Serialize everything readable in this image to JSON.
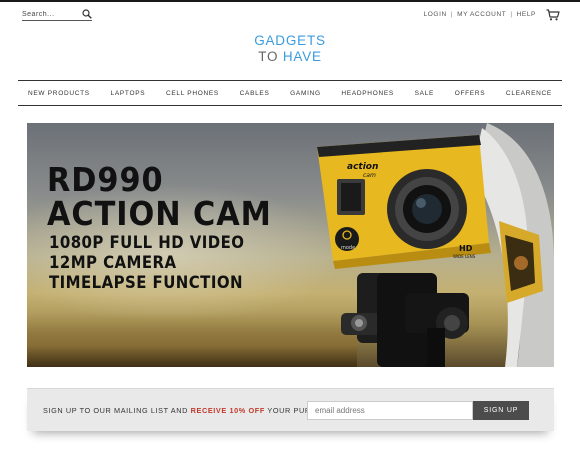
{
  "header": {
    "search": {
      "placeholder": "Search..."
    },
    "account_links": [
      "LOGIN",
      "MY ACCOUNT",
      "HELP"
    ],
    "separator": "|"
  },
  "logo": {
    "line1": "GADGETS",
    "line2_prefix": "TO ",
    "line2_accent": "HAVE"
  },
  "nav": {
    "items": [
      "NEW PRODUCTS",
      "LAPTOPS",
      "CELL PHONES",
      "CABLES",
      "GAMING",
      "HEADPHONES",
      "SALE",
      "OFFERS",
      "CLEARENCE"
    ]
  },
  "banner": {
    "headline": [
      "RD990",
      "ACTION CAM"
    ],
    "specs": [
      "1080P FULL HD VIDEO",
      "12MP CAMERA",
      "TIMELAPSE FUNCTION"
    ],
    "camera_brand": "action",
    "camera_sub": "cam",
    "camera_mode": "mode",
    "camera_hd": "HD",
    "camera_lens": "WIDE LENS"
  },
  "mailing": {
    "text_before": "SIGN UP TO OUR MAILING LIST AND ",
    "highlight": "RECEIVE 10% OFF",
    "text_after": " YOUR PURCHASE",
    "email_placeholder": "email address",
    "button": "SIGN UP"
  },
  "colors": {
    "accent_blue": "#3b9be0",
    "highlight_red": "#c0392b",
    "camera_yellow": "#e8b820",
    "button_dark": "#4c4c4c"
  },
  "icons": {
    "search": "search-icon",
    "cart": "cart-icon"
  }
}
